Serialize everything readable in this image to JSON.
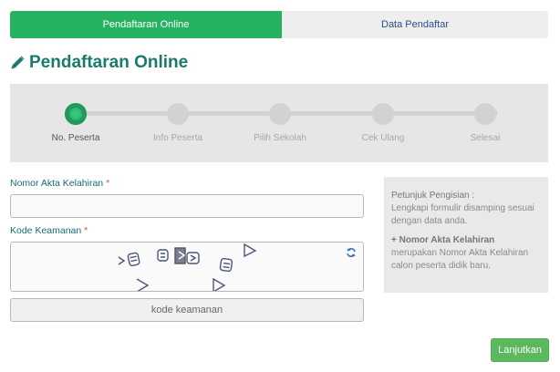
{
  "tabs": {
    "active_label": "Pendaftaran Online",
    "inactive_label": "Data Pendaftar"
  },
  "page": {
    "title": "Pendaftaran Online",
    "title_icon": "pencil-icon"
  },
  "stepper": {
    "steps": [
      {
        "label": "No. Peserta",
        "active": true
      },
      {
        "label": "Info Peserta",
        "active": false
      },
      {
        "label": "Pilih Sekolah",
        "active": false
      },
      {
        "label": "Cek Ulang",
        "active": false
      },
      {
        "label": "Selesai",
        "active": false
      }
    ]
  },
  "form": {
    "akta": {
      "label": "Nomor Akta Kelahiran",
      "required_mark": "*",
      "value": ""
    },
    "kode": {
      "label": "Kode Keamanan",
      "required_mark": "*"
    },
    "captcha": {
      "refresh_icon": "refresh-icon"
    },
    "code_input": {
      "placeholder": "kode keamanan",
      "value": ""
    }
  },
  "help": {
    "title": "Petunjuk Pengisian :",
    "intro": "Lengkapi formulir disamping sesuai dengan data anda.",
    "item_title": "+ Nomor Akta Kelahiran",
    "item_text": "merupakan Nomor Akta Kelahiran calon peserta didik baru."
  },
  "actions": {
    "submit_label": "Lanjutkan"
  },
  "colors": {
    "primary": "#26b260",
    "title": "#1a7b6c",
    "inactive_tab_text": "#2a4f8a",
    "required": "#d9534f"
  }
}
